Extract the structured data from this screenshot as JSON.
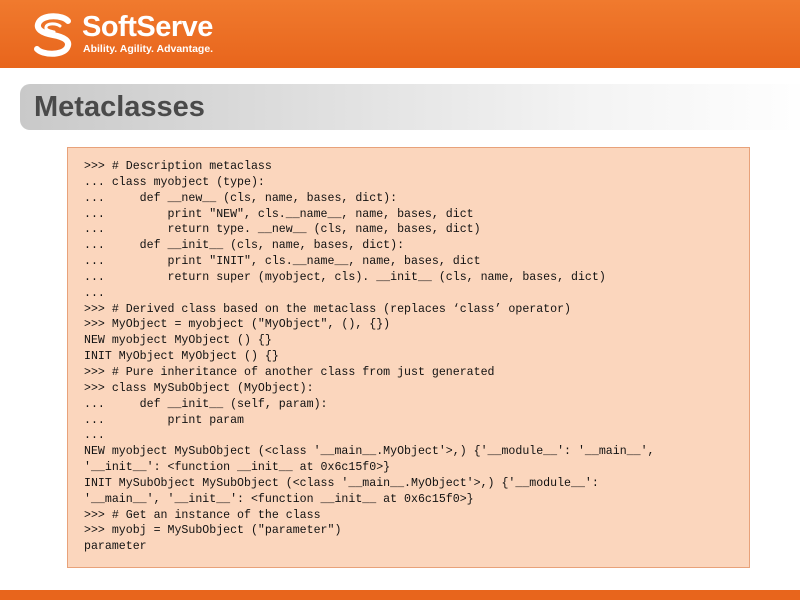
{
  "header": {
    "brand_name": "SoftServe",
    "tagline": "Ability. Agility. Advantage."
  },
  "slide": {
    "title": "Metaclasses"
  },
  "code_lines": [
    ">>> # Description metaclass",
    "... class myobject (type):",
    "...     def __new__ (cls, name, bases, dict):",
    "...         print \"NEW\", cls.__name__, name, bases, dict",
    "...         return type. __new__ (cls, name, bases, dict)",
    "...     def __init__ (cls, name, bases, dict):",
    "...         print \"INIT\", cls.__name__, name, bases, dict",
    "...         return super (myobject, cls). __init__ (cls, name, bases, dict)",
    "...",
    ">>> # Derived class based on the metaclass (replaces ‘class’ operator)",
    ">>> MyObject = myobject (\"MyObject\", (), {})",
    "NEW myobject MyObject () {}",
    "INIT MyObject MyObject () {}",
    ">>> # Pure inheritance of another class from just generated",
    ">>> class MySubObject (MyObject):",
    "...     def __init__ (self, param):",
    "...         print param",
    "...",
    "NEW myobject MySubObject (<class '__main__.MyObject'>,) {'__module__': '__main__',",
    "'__init__': <function __init__ at 0x6c15f0>}",
    "INIT MySubObject MySubObject (<class '__main__.MyObject'>,) {'__module__':",
    "'__main__', '__init__': <function __init__ at 0x6c15f0>}",
    ">>> # Get an instance of the class",
    ">>> myobj = MySubObject (\"parameter\")",
    "parameter"
  ],
  "colors": {
    "brand_orange": "#e8651c",
    "code_background": "#fbd6bd",
    "title_text": "#4a4a4a"
  }
}
